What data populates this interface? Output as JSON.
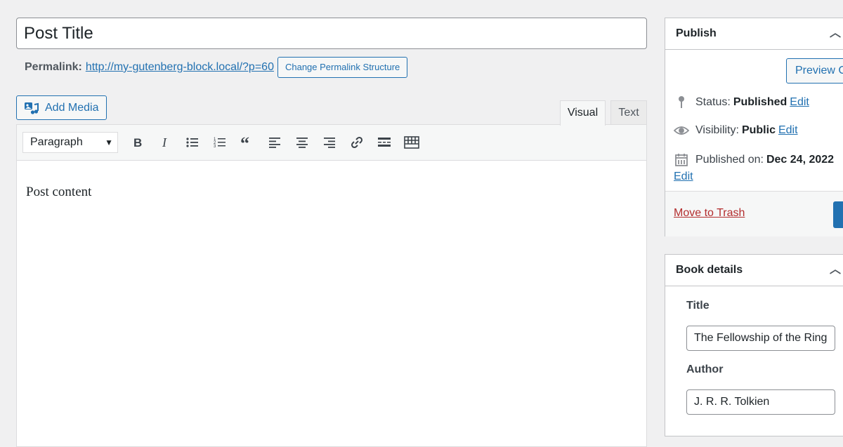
{
  "post": {
    "title": "Post Title",
    "permalink_label": "Permalink:",
    "permalink_url": "http://my-gutenberg-block.local/?p=60",
    "change_permalink_label": "Change Permalink Structure"
  },
  "editor": {
    "add_media_label": "Add Media",
    "tabs": [
      {
        "label": "Visual",
        "active": true
      },
      {
        "label": "Text",
        "active": false
      }
    ],
    "format_value": "Paragraph",
    "toolbar_icons": [
      "bold-icon",
      "italic-icon",
      "bullet-list-icon",
      "numbered-list-icon",
      "blockquote-icon",
      "align-left-icon",
      "align-center-icon",
      "align-right-icon",
      "link-icon",
      "read-more-icon",
      "toolbar-toggle-icon"
    ],
    "content": "Post content"
  },
  "publish": {
    "heading": "Publish",
    "preview_label": "Preview C",
    "status_label": "Status:",
    "status_value": "Published",
    "visibility_label": "Visibility:",
    "visibility_value": "Public",
    "published_label": "Published on:",
    "published_value": "Dec 24, 2022",
    "edit_label": "Edit",
    "trash_label": "Move to Trash"
  },
  "book_details": {
    "heading": "Book details",
    "title_label": "Title",
    "title_value": "The Fellowship of the Ring",
    "author_label": "Author",
    "author_value": "J. R. R. Tolkien"
  },
  "colors": {
    "accent": "#2271b1",
    "danger": "#b32d2e",
    "background": "#f0f0f1"
  }
}
